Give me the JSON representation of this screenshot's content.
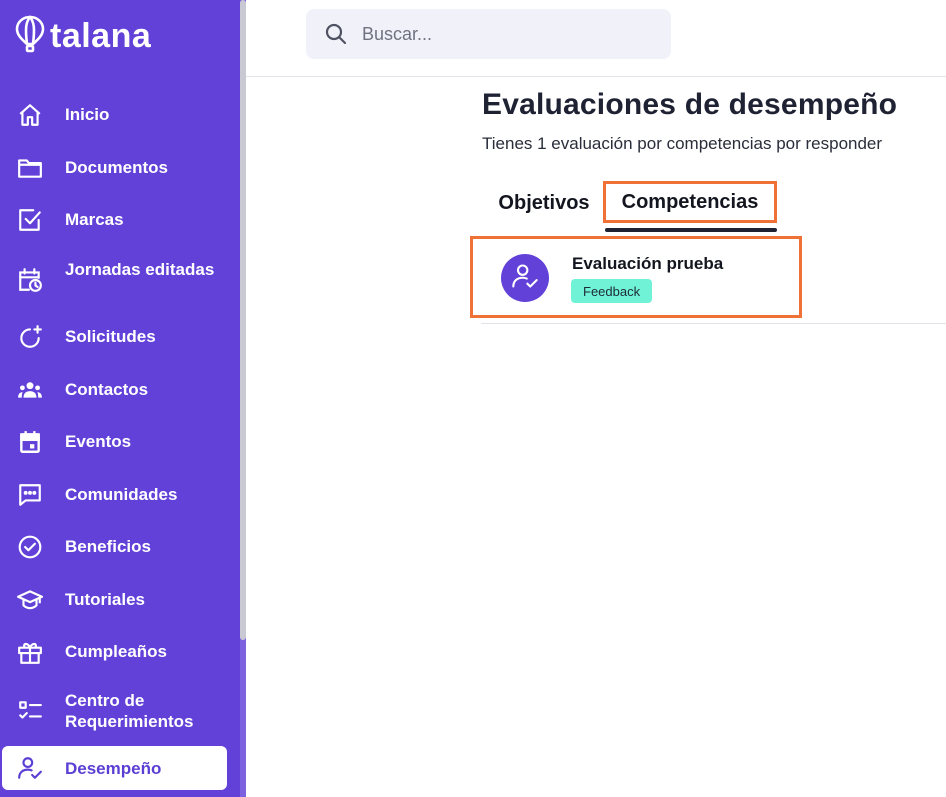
{
  "brand": {
    "name": "talana",
    "accent": "#6241d9",
    "highlight": "#f07136",
    "badge_color": "#6ff2d5"
  },
  "sidebar": {
    "items": [
      {
        "label": "Inicio",
        "icon": "home-icon"
      },
      {
        "label": "Documentos",
        "icon": "folder-icon"
      },
      {
        "label": "Marcas",
        "icon": "checkbox-icon"
      },
      {
        "label": "Jornadas editadas",
        "icon": "calendar-clock-icon"
      },
      {
        "label": "Solicitudes",
        "icon": "refresh-plus-icon"
      },
      {
        "label": "Contactos",
        "icon": "people-icon"
      },
      {
        "label": "Eventos",
        "icon": "calendar-icon"
      },
      {
        "label": "Comunidades",
        "icon": "chat-icon"
      },
      {
        "label": "Beneficios",
        "icon": "check-circle-icon"
      },
      {
        "label": "Tutoriales",
        "icon": "graduation-cap-icon"
      },
      {
        "label": "Cumpleaños",
        "icon": "gift-icon"
      },
      {
        "label": "Centro de Requerimientos",
        "icon": "checklist-icon"
      },
      {
        "label": "Desempeño",
        "icon": "user-check-icon",
        "active": true
      }
    ]
  },
  "header": {
    "search_placeholder": "Buscar..."
  },
  "main": {
    "title": "Evaluaciones de desempeño",
    "subtitle": "Tienes 1 evaluación por competencias por responder",
    "tabs": [
      {
        "label": "Objetivos",
        "active": false
      },
      {
        "label": "Competencias",
        "active": true
      }
    ],
    "evaluations": [
      {
        "title": "Evaluación prueba",
        "badge": "Feedback",
        "icon": "user-check-icon"
      }
    ]
  }
}
